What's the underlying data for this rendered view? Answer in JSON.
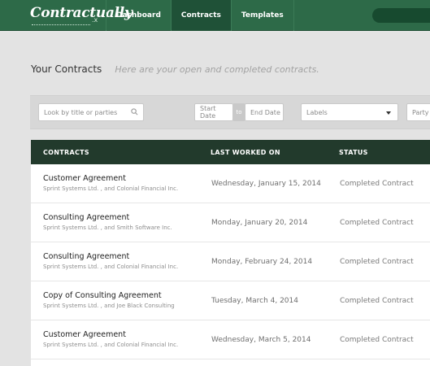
{
  "app": {
    "logo": "Contractually",
    "logo_suffix": ".x"
  },
  "nav": {
    "items": [
      {
        "label": "Dashboard"
      },
      {
        "label": "Contracts"
      },
      {
        "label": "Templates"
      }
    ]
  },
  "page": {
    "title": "Your Contracts",
    "subtitle": "Here are your open and completed contracts."
  },
  "filters": {
    "search_placeholder": "Look by title or parties",
    "start_date_placeholder": "Start Date",
    "date_separator": "to",
    "end_date_placeholder": "End Date",
    "labels_placeholder": "Labels",
    "party_placeholder": "Party"
  },
  "table": {
    "headers": [
      "CONTRACTS",
      "LAST WORKED ON",
      "STATUS"
    ],
    "rows": [
      {
        "title": "Customer Agreement",
        "parties": "Sprint Systems Ltd. , and Colonial Financial Inc.",
        "date": "Wednesday, January 15, 2014",
        "status": "Completed Contract"
      },
      {
        "title": "Consulting Agreement",
        "parties": "Sprint Systems Ltd. , and Smith Software Inc.",
        "date": "Monday, January 20, 2014",
        "status": "Completed Contract"
      },
      {
        "title": "Consulting Agreement",
        "parties": "Sprint Systems Ltd. , and Colonial Financial Inc.",
        "date": "Monday, February 24, 2014",
        "status": "Completed Contract"
      },
      {
        "title": "Copy of Consulting Agreement",
        "parties": "Sprint Systems Ltd. , and Joe Black Consulting",
        "date": "Tuesday, March 4, 2014",
        "status": "Completed Contract"
      },
      {
        "title": "Customer Agreement",
        "parties": "Sprint Systems Ltd. , and Colonial Financial Inc.",
        "date": "Wednesday, March 5, 2014",
        "status": "Completed Contract"
      }
    ]
  },
  "colors": {
    "topbar": "#2d6a48",
    "nav_active": "#1f5137",
    "table_header": "#223a2c",
    "background": "#e3e3e3"
  },
  "icons": {
    "search": "search-icon",
    "labels_dropdown": "chevron-down-icon"
  }
}
